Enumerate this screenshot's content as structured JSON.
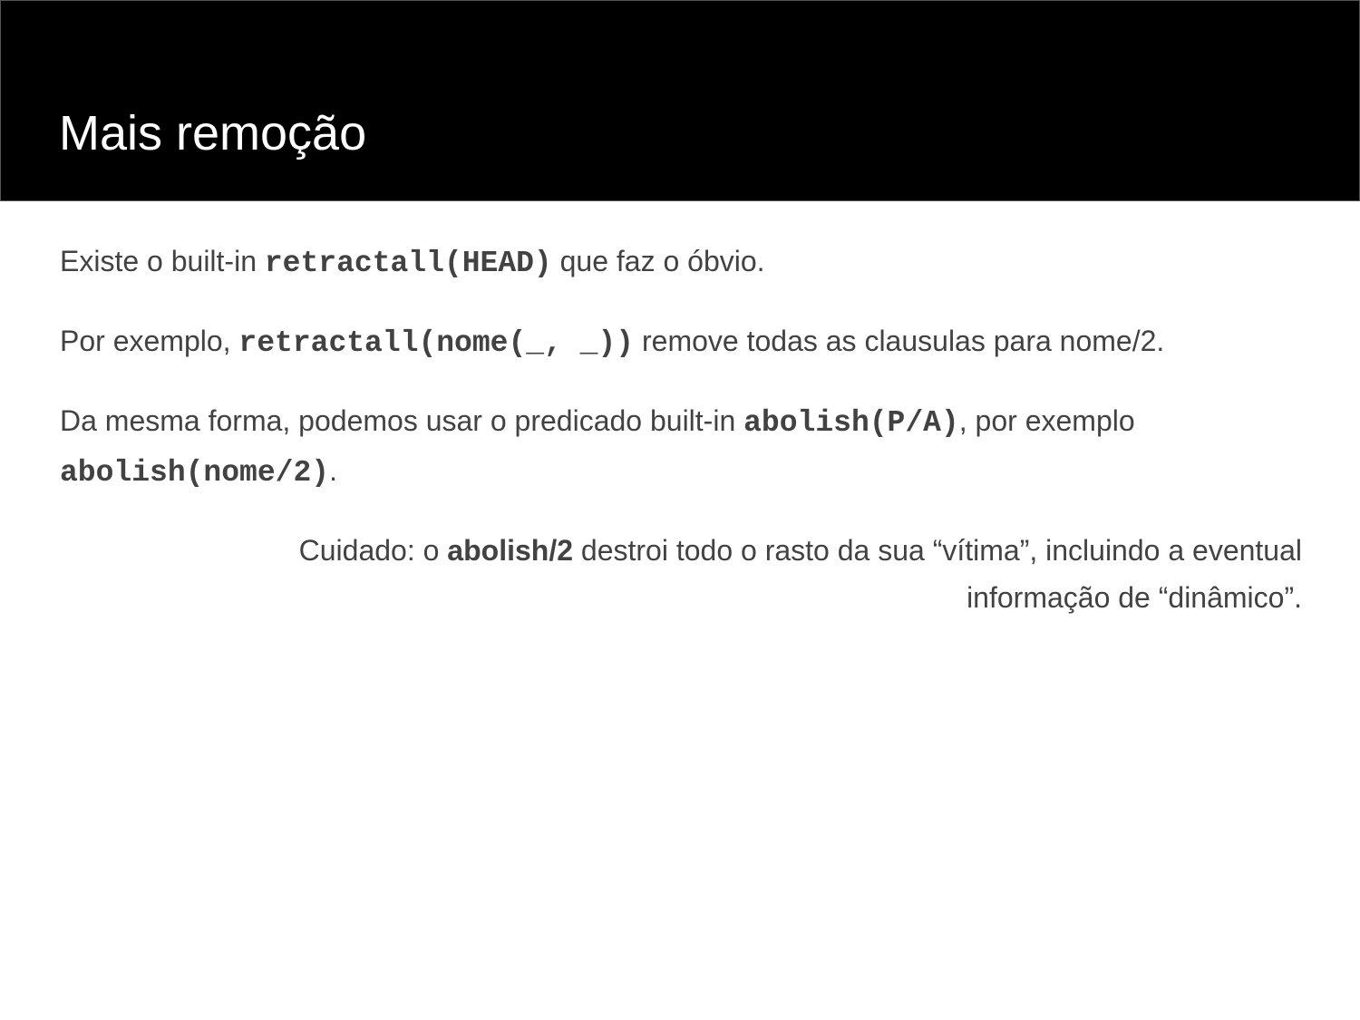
{
  "slide": {
    "title": "Mais remoção",
    "p1": {
      "before": "Existe o built-in ",
      "code": "retractall(HEAD)",
      "after": " que faz o óbvio."
    },
    "p2": {
      "before": "Por exemplo, ",
      "code": "retractall(nome(_, _))",
      "after": " remove todas as clausulas para nome/2."
    },
    "p3": {
      "before": "Da mesma forma, podemos usar o predicado built-in ",
      "code1": "abolish(P/A)",
      "middle": ", por exemplo ",
      "code2": "abolish(nome/2)",
      "after": "."
    },
    "note": {
      "before": "Cuidado: o ",
      "bold": "abolish/2",
      "after": " destroi todo o rasto da sua “vítima”, incluindo a eventual informação de “dinâmico”."
    }
  }
}
